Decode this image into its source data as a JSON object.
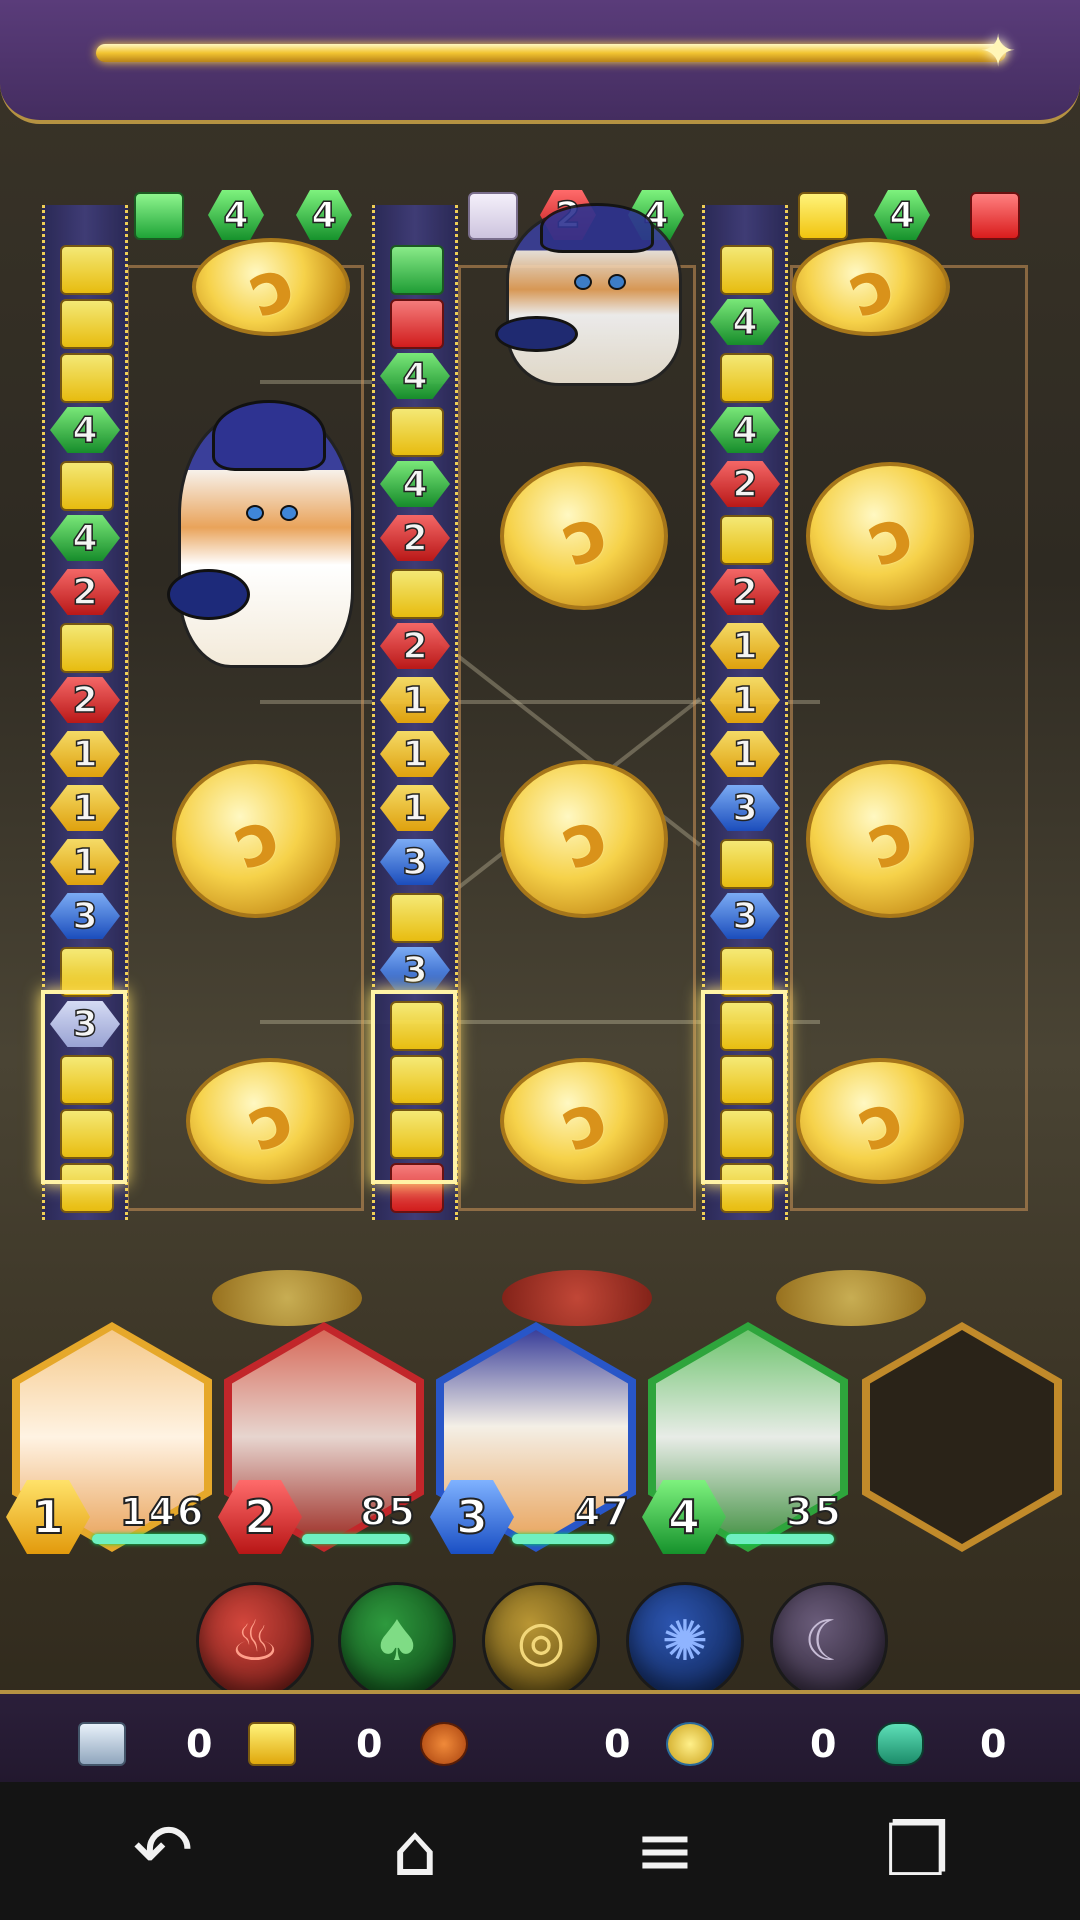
{
  "colors": {
    "accent_gold": "#f2c431",
    "panel_purple": "#4a3168",
    "hp_bar": "#6ef0c0"
  },
  "top_pieces": [
    {
      "kind": "square",
      "color": "green"
    },
    {
      "kind": "hex",
      "color": "green",
      "value": "4"
    },
    {
      "kind": "hex",
      "color": "green",
      "value": "4"
    },
    {
      "kind": "square",
      "color": "lavender"
    },
    {
      "kind": "hex",
      "color": "red",
      "value": "2"
    },
    {
      "kind": "hex",
      "color": "green",
      "value": "4"
    },
    {
      "kind": "square",
      "color": "yellow"
    },
    {
      "kind": "hex",
      "color": "green",
      "value": "4"
    },
    {
      "kind": "square",
      "color": "red"
    }
  ],
  "lanes": [
    {
      "name": "lane-1",
      "pieces": [
        "sq-yellow",
        "sq-yellow",
        "sq-yellow",
        "h4",
        "sq-yellow",
        "h4",
        "h2",
        "sq-yellow",
        "h2",
        "h1",
        "h1",
        "h1",
        "h3",
        "sq-yellow",
        "h3p",
        "sq-yellow",
        "sq-yellow",
        "sq-yellow"
      ]
    },
    {
      "name": "lane-2",
      "pieces": [
        "sq-green",
        "sq-red",
        "h4",
        "sq-yellow",
        "h4",
        "h2",
        "sq-yellow",
        "h2",
        "h1",
        "h1",
        "h1",
        "h3",
        "sq-yellow",
        "h3",
        "sq-yellow",
        "sq-yellow",
        "sq-yellow",
        "sq-red"
      ]
    },
    {
      "name": "lane-3",
      "pieces": [
        "sq-yellow",
        "h4",
        "sq-yellow",
        "h4",
        "h2",
        "sq-yellow",
        "h2",
        "h1",
        "h1",
        "h1",
        "h3",
        "sq-yellow",
        "h3",
        "sq-yellow",
        "sq-yellow",
        "sq-yellow",
        "sq-yellow",
        "sq-yellow"
      ]
    }
  ],
  "labels": {
    "h1": "1",
    "h2": "2",
    "h3": "3",
    "h4": "4"
  },
  "units": [
    {
      "slot": "1",
      "hp": "146",
      "hp_fraction": 0.95,
      "color": "yellow"
    },
    {
      "slot": "2",
      "hp": "85",
      "hp_fraction": 0.9,
      "color": "red"
    },
    {
      "slot": "3",
      "hp": "47",
      "hp_fraction": 0.85,
      "color": "blue"
    },
    {
      "slot": "4",
      "hp": "35",
      "hp_fraction": 0.9,
      "color": "green"
    }
  ],
  "elements": [
    {
      "name": "fire-orb-icon",
      "glyph": "♨",
      "color": "#b3231e"
    },
    {
      "name": "forest-orb-icon",
      "glyph": "♠",
      "color": "#1f7a2a"
    },
    {
      "name": "lightning-orb-icon",
      "glyph": "◎",
      "color": "#9c7a1c"
    },
    {
      "name": "water-orb-icon",
      "glyph": "✺",
      "color": "#1c3f88"
    },
    {
      "name": "moon-orb-icon",
      "glyph": "☾",
      "color": "#4b3e5a"
    }
  ],
  "counters": [
    {
      "name": "silver-block-count",
      "value": "0",
      "color": "#c7d4e2"
    },
    {
      "name": "gold-block-count",
      "value": "0",
      "color": "#f1c40f"
    },
    {
      "name": "cat-medal-count",
      "value": "0",
      "color": "#e06a1e"
    },
    {
      "name": "gold-coin-count",
      "value": "0",
      "color": "#f3d23a"
    },
    {
      "name": "ghost-cat-count",
      "value": "0",
      "color": "#2fbf9a"
    }
  ],
  "nav": {
    "back": "↶",
    "home": "⌂",
    "menu": "≡",
    "recent": "❐"
  }
}
